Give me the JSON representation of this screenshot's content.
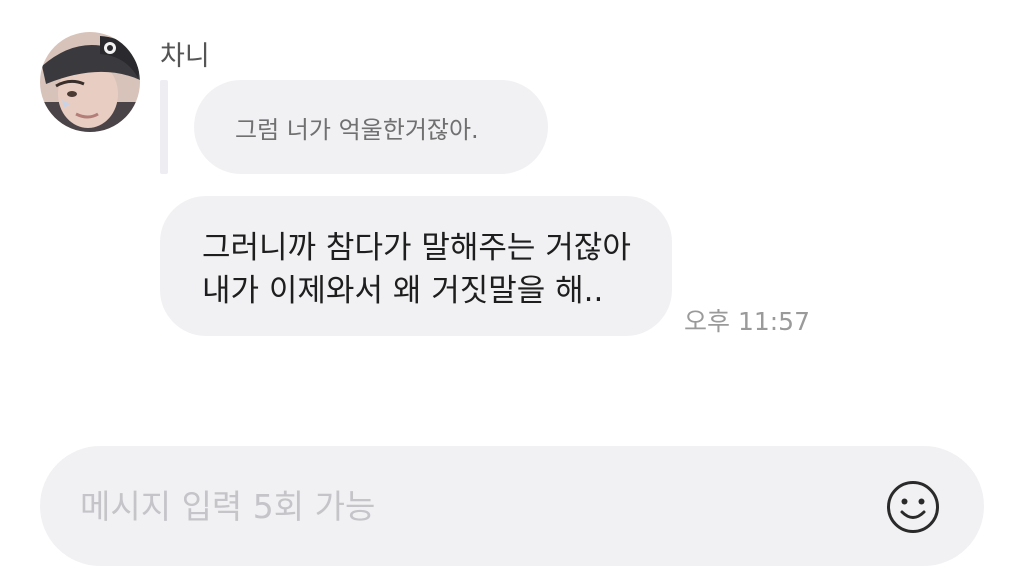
{
  "chat": {
    "sender_name": "차니",
    "avatar_alt": "sender-avatar",
    "quoted_message": "그럼 너가 억울한거잖아.",
    "message": {
      "lines": [
        "그러니까 참다가 말해주는 거잖아",
        "내가 이제와서 왜 거짓말을 해.."
      ],
      "time": "오후 11:57"
    }
  },
  "composer": {
    "placeholder": "메시지 입력 5회 가능",
    "value": "",
    "emoji_icon": "smiley-icon"
  },
  "colors": {
    "bubble": "#f1f1f4",
    "quote_text": "#707070",
    "message_text": "#1e1e1e",
    "time_text": "#9a9a9a",
    "placeholder_text": "#c5c5c9"
  }
}
